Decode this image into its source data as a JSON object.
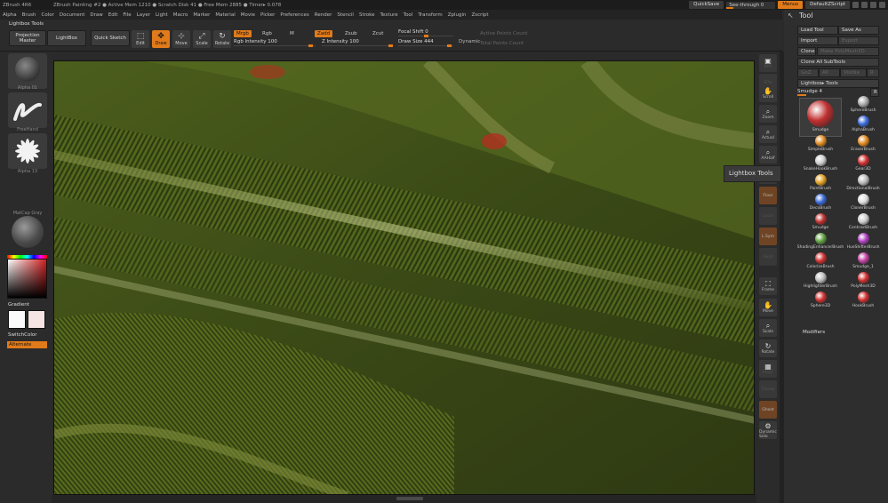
{
  "titlebar": {
    "app": "ZBrush 4R6",
    "info": "ZBrush Painting #2  ●  Active Mem 1210  ●  Scratch Disk 41  ●  Free Mem 2885  ●  Timer▸ 0.078",
    "quicksave": "QuickSave",
    "seethrough": "See-through",
    "seethrough_value": "0",
    "menus": "Menus",
    "defaultzscript": "DefaultZScript"
  },
  "menu": [
    "Alpha",
    "Brush",
    "Color",
    "Document",
    "Draw",
    "Edit",
    "File",
    "Layer",
    "Light",
    "Macro",
    "Marker",
    "Material",
    "Movie",
    "Picker",
    "Preferences",
    "Render",
    "Stencil",
    "Stroke",
    "Texture",
    "Tool",
    "Transform",
    "Zplugin",
    "Zscript"
  ],
  "shelf": {
    "lightbox_tools": "Lightbox Tools",
    "projection_master": "Projection Master",
    "lightbox": "LightBox",
    "quick_sketch": "Quick Sketch",
    "tools": [
      "Edit",
      "Draw",
      "Move",
      "Scale",
      "Rotate"
    ],
    "mrgb": "Mrgb",
    "rgb": "Rgb",
    "m": "M",
    "rgb_intensity": "Rgb Intensity",
    "rgb_intensity_value": "100",
    "zadd": "Zadd",
    "zsub": "Zsub",
    "zcut": "Zcut",
    "z_intensity": "Z Intensity",
    "z_intensity_value": "100",
    "focal_shift": "Focal Shift",
    "focal_shift_value": "0",
    "draw_size": "Draw Size",
    "draw_size_value": "444",
    "dynamic": "Dynamic",
    "active_points": "Active Points Count",
    "total_points": "Total Points Count"
  },
  "left": {
    "alpha_label": "Alpha 01",
    "stroke_label": "FreeHand",
    "alpha2_label": "Alpha 13",
    "material_label": "MatCap Gray",
    "gradient": "Gradient",
    "switchcolor": "SwitchColor",
    "alternate": "Alternate"
  },
  "rightshelf": [
    "BPR",
    "SPix",
    "Scroll",
    "Zoom",
    "Actual",
    "AAHalf",
    "Persp",
    "Floor",
    "Local",
    "L.Sym",
    "Gxyz",
    "Frame",
    "Move",
    "Scale",
    "Rotate",
    "PolyF",
    "Transp",
    "Ghost",
    "Dynamic Solo"
  ],
  "toolpanel": {
    "title": "Tool",
    "load_tool": "Load Tool",
    "save_as": "Save As",
    "import": "Import",
    "export": "Export",
    "clone": "Clone",
    "make_polymesh": "Make PolyMesh3D",
    "clone_all": "Clone All SubTools",
    "goz": "GoZ",
    "all": "All",
    "visible": "Visible",
    "r": "R",
    "lightbox_tools": "Lightbox▸ Tools",
    "current": "Smudge",
    "current_value": "4",
    "r2": "R",
    "brushes": [
      {
        "label": "Smudge",
        "color": "#c03030"
      },
      {
        "label": "SphereBrush",
        "color": "#aaaaaa"
      },
      {
        "label": "AlphaBrush",
        "color": "#3a6ad8"
      },
      {
        "label": "SimpleBrush",
        "color": "#e08a20"
      },
      {
        "label": "EraserBrush",
        "color": "#e08a20"
      },
      {
        "label": "SnakeHookBrush",
        "color": "#cccccc"
      },
      {
        "label": "Gear3D",
        "color": "#d03030"
      },
      {
        "label": "PaintBrush",
        "color": "#e0a020"
      },
      {
        "label": "DirectionalBrush",
        "color": "#bbbbbb"
      },
      {
        "label": "DecoBrush",
        "color": "#3a6ad8"
      },
      {
        "label": "ClonerBrush",
        "color": "#dddddd"
      },
      {
        "label": "Smudge",
        "color": "#c03030"
      },
      {
        "label": "ContrastBrush",
        "color": "#cccccc"
      },
      {
        "label": "ShadingEnhancerBrush",
        "color": "#60a040"
      },
      {
        "label": "HueShifterBrush",
        "color": "#b040c0"
      },
      {
        "label": "ColorizeBrush",
        "color": "#d03030"
      },
      {
        "label": "Smudge_1",
        "color": "#c040a0"
      },
      {
        "label": "HighlighterBrush",
        "color": "#bbbbbb"
      },
      {
        "label": "PolyMesh3D",
        "color": "#d03030"
      },
      {
        "label": "Sphere3D",
        "color": "#d03030"
      },
      {
        "label": "HookBrush",
        "color": "#d03030"
      }
    ],
    "modifiers": "Modifiers"
  },
  "tooltip": "Lightbox Tools"
}
